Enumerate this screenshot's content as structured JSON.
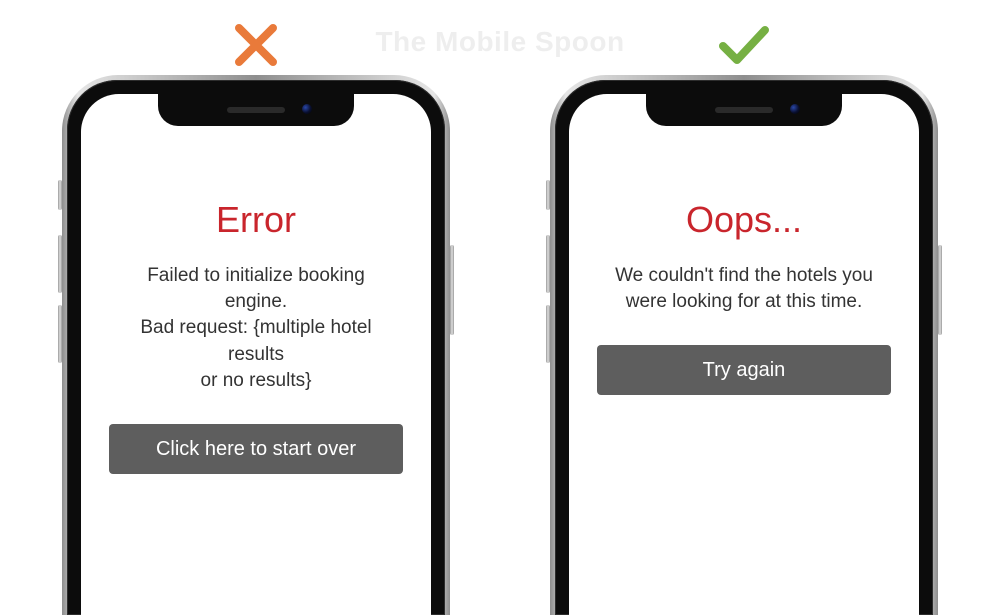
{
  "watermark": "The Mobile Spoon",
  "left": {
    "mark": "cross",
    "title": "Error",
    "body_l1": "Failed to initialize booking engine.",
    "body_l2": "Bad request: {multiple hotel results",
    "body_l3": "or no results}",
    "button": "Click here to start over"
  },
  "right": {
    "mark": "check",
    "title": "Oops...",
    "body_l1": "We couldn't find the hotels you",
    "body_l2": "were looking for at this time.",
    "body_l3": "",
    "button": "Try again"
  }
}
